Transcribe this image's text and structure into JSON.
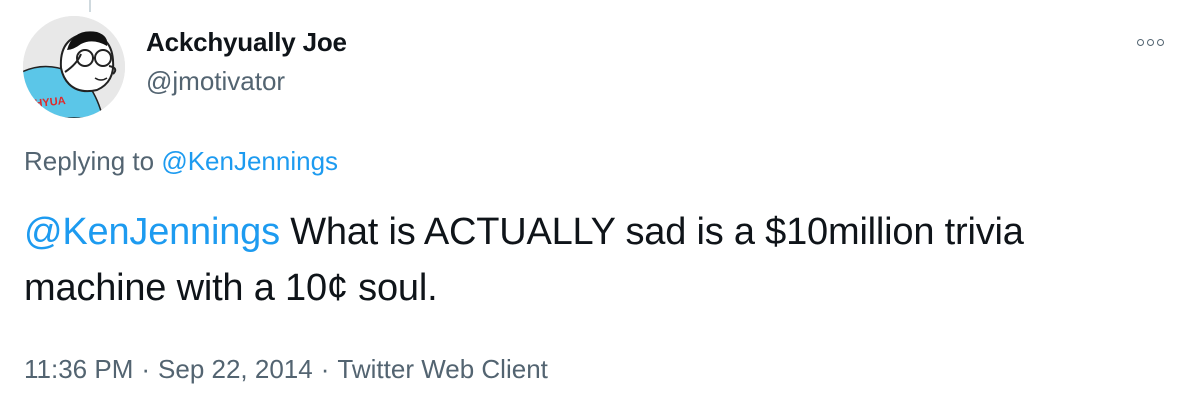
{
  "author": {
    "display_name": "Ackchyually Joe",
    "handle": "@jmotivator",
    "avatar_text": "CHYUA"
  },
  "reply": {
    "prefix": "Replying to",
    "mention": "@KenJennings"
  },
  "tweet": {
    "mention": "@KenJennings",
    "body": "What is ACTUALLY sad is a $10million trivia machine with a 10¢ soul."
  },
  "meta": {
    "time": "11:36 PM",
    "date": "Sep 22, 2014",
    "source": "Twitter Web Client",
    "separator": "·"
  },
  "icons": {
    "more": "more-options-icon"
  },
  "colors": {
    "link": "#1d9bf0",
    "secondary_text": "#536471",
    "primary_text": "#0f1419",
    "avatar_shirt": "#5bc6e8",
    "avatar_label": "#e0282a"
  }
}
